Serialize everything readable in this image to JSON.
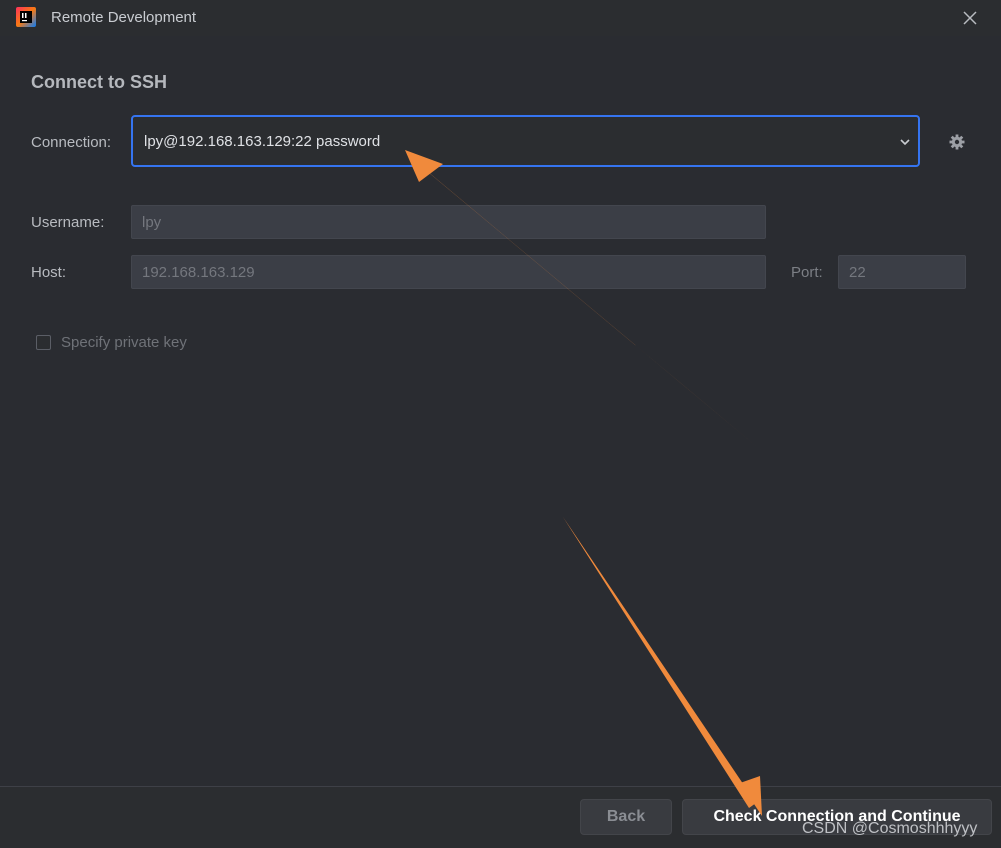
{
  "window": {
    "title": "Remote Development",
    "app_icon": "intellij-idea-icon",
    "close_icon": "close-icon"
  },
  "dialog": {
    "heading": "Connect to SSH",
    "connection": {
      "label": "Connection:",
      "value": "lpy@192.168.163.129:22 password",
      "dropdown_icon": "chevron-down-icon",
      "settings_icon": "gear-icon"
    },
    "username": {
      "label": "Username:",
      "value": "lpy"
    },
    "host": {
      "label": "Host:",
      "value": "192.168.163.129"
    },
    "port": {
      "label": "Port:",
      "value": "22"
    },
    "private_key": {
      "label": "Specify private key",
      "checked": false
    }
  },
  "footer": {
    "back_label": "Back",
    "primary_label": "Check Connection and Continue"
  },
  "annotations": {
    "arrow_color": "#f08a3c"
  },
  "watermark": "CSDN @Cosmoshhhyyy",
  "colors": {
    "accent": "#3574f0",
    "background": "#2b2d30"
  }
}
